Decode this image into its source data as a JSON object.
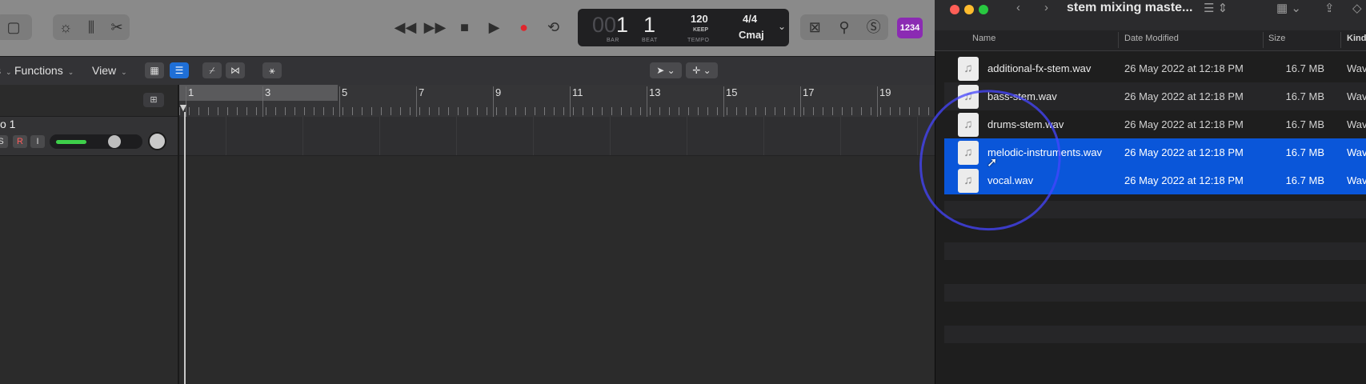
{
  "lcd": {
    "bar": "1",
    "bar_prefix": "00",
    "beat": "1",
    "bar_label": "BAR",
    "beat_label": "BEAT",
    "tempo": "120",
    "tempo_mode": "KEEP",
    "tempo_label": "TEMPO",
    "time_signature": "4/4",
    "key": "Cmaj"
  },
  "toolbar": {
    "badge": "1234"
  },
  "menubar": {
    "functions": "Functions",
    "view": "View"
  },
  "track": {
    "name": "o 1",
    "solo": "S",
    "record": "R",
    "input": "I"
  },
  "ruler": {
    "bars": [
      "1",
      "3",
      "5",
      "7",
      "9",
      "11",
      "13",
      "15",
      "17",
      "19"
    ]
  },
  "finder": {
    "title": "stem mixing maste...",
    "columns": {
      "name": "Name",
      "date": "Date Modified",
      "size": "Size",
      "kind": "Kind"
    },
    "files": [
      {
        "name": "additional-fx-stem.wav",
        "date": "26 May 2022 at 12:18 PM",
        "size": "16.7 MB",
        "kind": "Wav",
        "selected": false
      },
      {
        "name": "bass-stem.wav",
        "date": "26 May 2022 at 12:18 PM",
        "size": "16.7 MB",
        "kind": "Wav",
        "selected": false
      },
      {
        "name": "drums-stem.wav",
        "date": "26 May 2022 at 12:18 PM",
        "size": "16.7 MB",
        "kind": "Wav",
        "selected": false
      },
      {
        "name": "melodic-instruments.wav",
        "date": "26 May 2022 at 12:18 PM",
        "size": "16.7 MB",
        "kind": "Wav",
        "selected": true
      },
      {
        "name": "vocal.wav",
        "date": "26 May 2022 at 12:18 PM",
        "size": "16.7 MB",
        "kind": "Wav",
        "selected": true
      }
    ]
  },
  "colors": {
    "selection": "#0a56d9",
    "record": "#e0262d",
    "badge": "#8b2bb3",
    "fader_level": "#3ecf4a",
    "annotation": "#4646ff"
  },
  "icons": [
    "brightness-icon",
    "mixer-icon",
    "scissors-icon",
    "rewind-icon",
    "fast-forward-icon",
    "stop-icon",
    "play-icon",
    "record-icon",
    "cycle-icon",
    "tuner-icon",
    "metronome-icon",
    "back-icon",
    "forward-icon",
    "list-view-icon",
    "grid-view-icon",
    "share-icon",
    "music-file-icon",
    "pointer-tool-icon"
  ]
}
